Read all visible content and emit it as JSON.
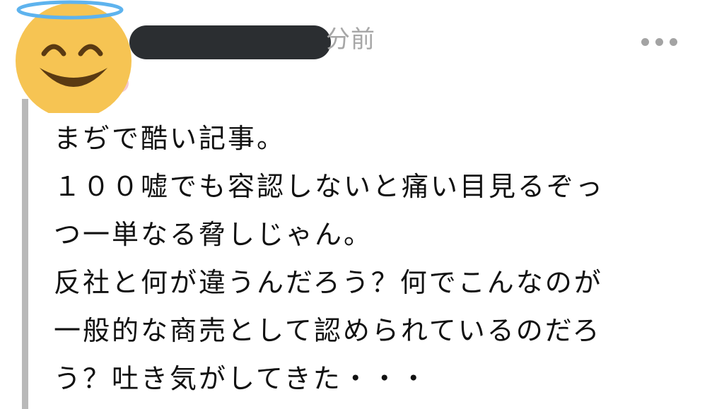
{
  "comment": {
    "avatar_icon": "angel-smiling-face-icon",
    "author_redacted": true,
    "timestamp": "分前",
    "more_icon": "more-horizontal-icon",
    "lines": [
      "まぢで酷い記事。",
      "１００嘘でも容認しないと痛い目見るぞっ",
      "つ一単なる脅しじゃん。",
      "反社と何が違うんだろう？何でこんなのが",
      "一般的な商売として認められているのだろ",
      "う？吐き気がしてきた・・・"
    ]
  },
  "colors": {
    "avatar_face": "#f6c453",
    "halo": "#5eb3ee",
    "redaction": "#2b2e31",
    "thread_line": "#b9b9b9",
    "timestamp": "#a7a7a7",
    "text": "#111111"
  }
}
